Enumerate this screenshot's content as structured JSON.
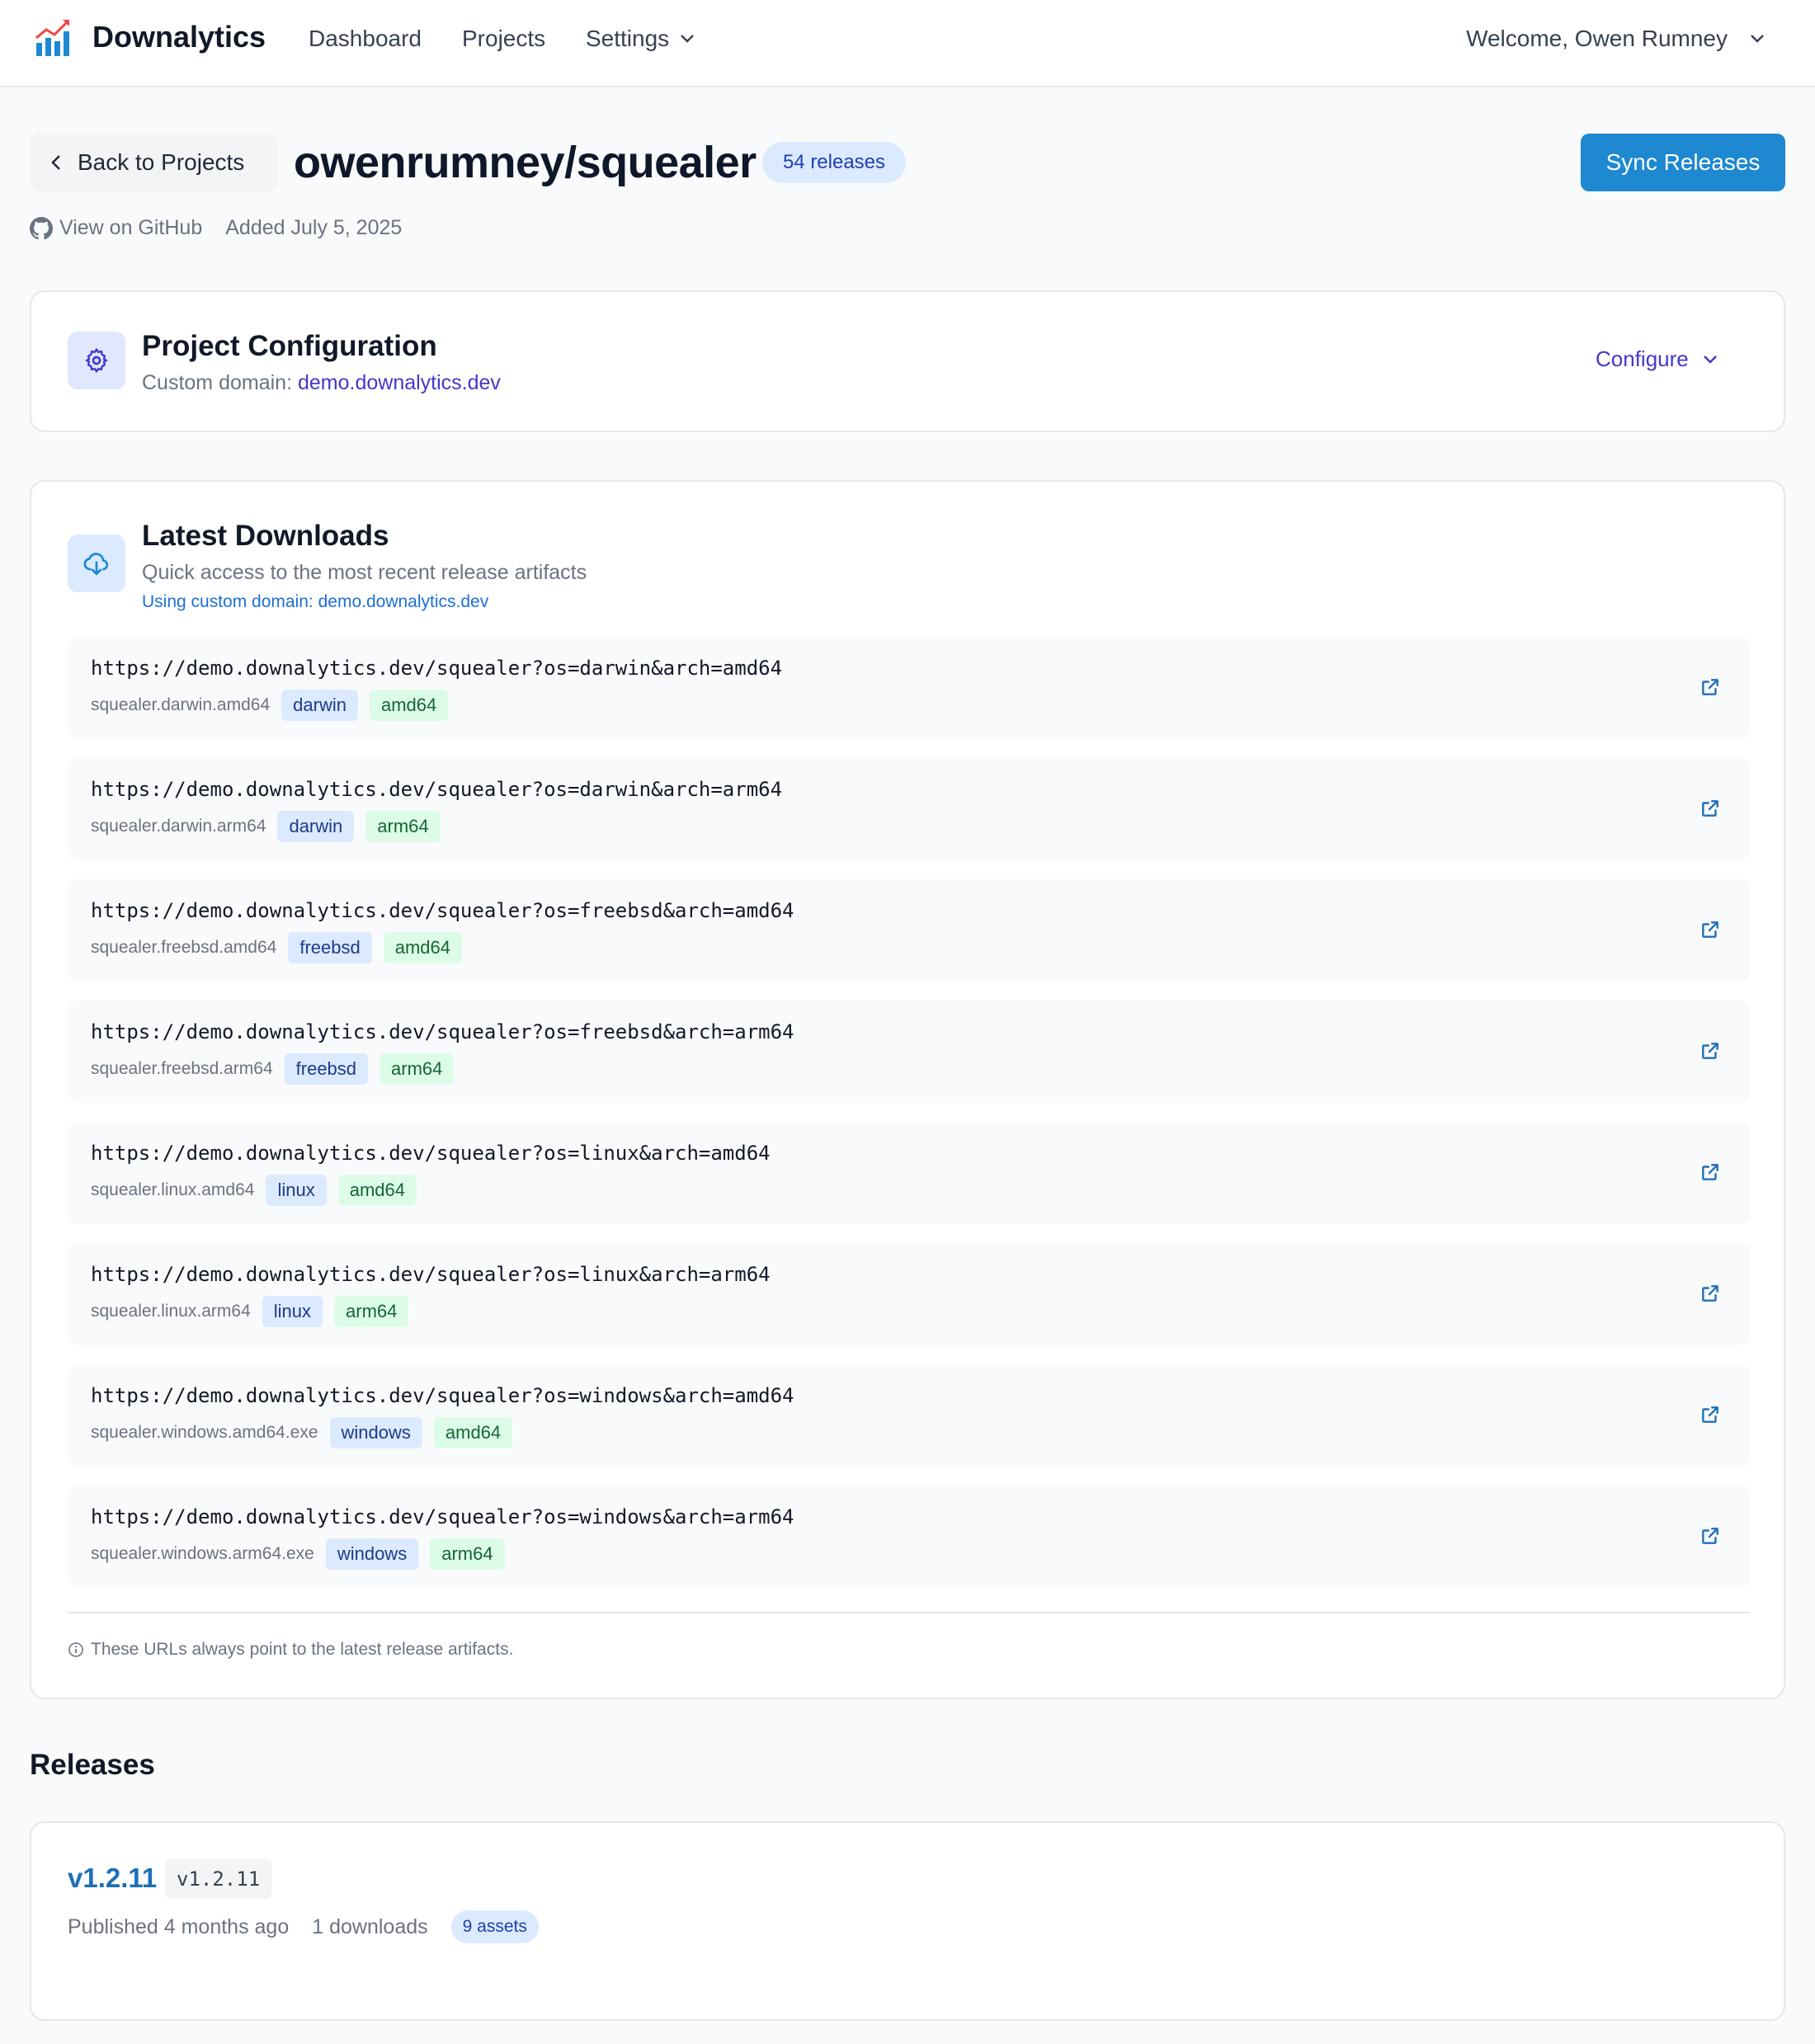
{
  "header": {
    "brand": "Downalytics",
    "nav": {
      "dashboard": "Dashboard",
      "projects": "Projects",
      "settings": "Settings"
    },
    "welcome": "Welcome, Owen Rumney"
  },
  "project": {
    "back_label": "Back to Projects",
    "title": "owenrumney/squealer",
    "release_count": "54 releases",
    "sync_label": "Sync Releases",
    "github_label": "View on GitHub",
    "added": "Added July 5, 2025"
  },
  "config": {
    "title": "Project Configuration",
    "subtitle_prefix": "Custom domain: ",
    "domain": "demo.downalytics.dev",
    "configure_label": "Configure"
  },
  "downloads": {
    "title": "Latest Downloads",
    "subtitle": "Quick access to the most recent release artifacts",
    "domain_note": "Using custom domain: demo.downalytics.dev",
    "items": [
      {
        "url": "https://demo.downalytics.dev/squealer?os=darwin&arch=amd64",
        "file": "squealer.darwin.amd64",
        "os": "darwin",
        "arch": "amd64"
      },
      {
        "url": "https://demo.downalytics.dev/squealer?os=darwin&arch=arm64",
        "file": "squealer.darwin.arm64",
        "os": "darwin",
        "arch": "arm64"
      },
      {
        "url": "https://demo.downalytics.dev/squealer?os=freebsd&arch=amd64",
        "file": "squealer.freebsd.amd64",
        "os": "freebsd",
        "arch": "amd64"
      },
      {
        "url": "https://demo.downalytics.dev/squealer?os=freebsd&arch=arm64",
        "file": "squealer.freebsd.arm64",
        "os": "freebsd",
        "arch": "arm64"
      },
      {
        "url": "https://demo.downalytics.dev/squealer?os=linux&arch=amd64",
        "file": "squealer.linux.amd64",
        "os": "linux",
        "arch": "amd64"
      },
      {
        "url": "https://demo.downalytics.dev/squealer?os=linux&arch=arm64",
        "file": "squealer.linux.arm64",
        "os": "linux",
        "arch": "arm64"
      },
      {
        "url": "https://demo.downalytics.dev/squealer?os=windows&arch=amd64",
        "file": "squealer.windows.amd64.exe",
        "os": "windows",
        "arch": "amd64"
      },
      {
        "url": "https://demo.downalytics.dev/squealer?os=windows&arch=arm64",
        "file": "squealer.windows.arm64.exe",
        "os": "windows",
        "arch": "arm64"
      }
    ],
    "footer_note": "These URLs always point to the latest release artifacts."
  },
  "releases": {
    "heading": "Releases",
    "items": [
      {
        "version": "v1.2.11",
        "tag": "v1.2.11",
        "published": "Published 4 months ago",
        "downloads": "1 downloads",
        "assets": "9 assets"
      }
    ]
  },
  "colors": {
    "primary": "#1e88d0",
    "indigo": "#4338ca",
    "os_tag_bg": "#dbeafe",
    "arch_tag_bg": "#dcfce7"
  },
  "icons": [
    "logo-chart-icon",
    "chevron-down-icon",
    "chevron-left-icon",
    "github-icon",
    "gear-icon",
    "cloud-download-icon",
    "external-link-icon",
    "info-icon"
  ]
}
